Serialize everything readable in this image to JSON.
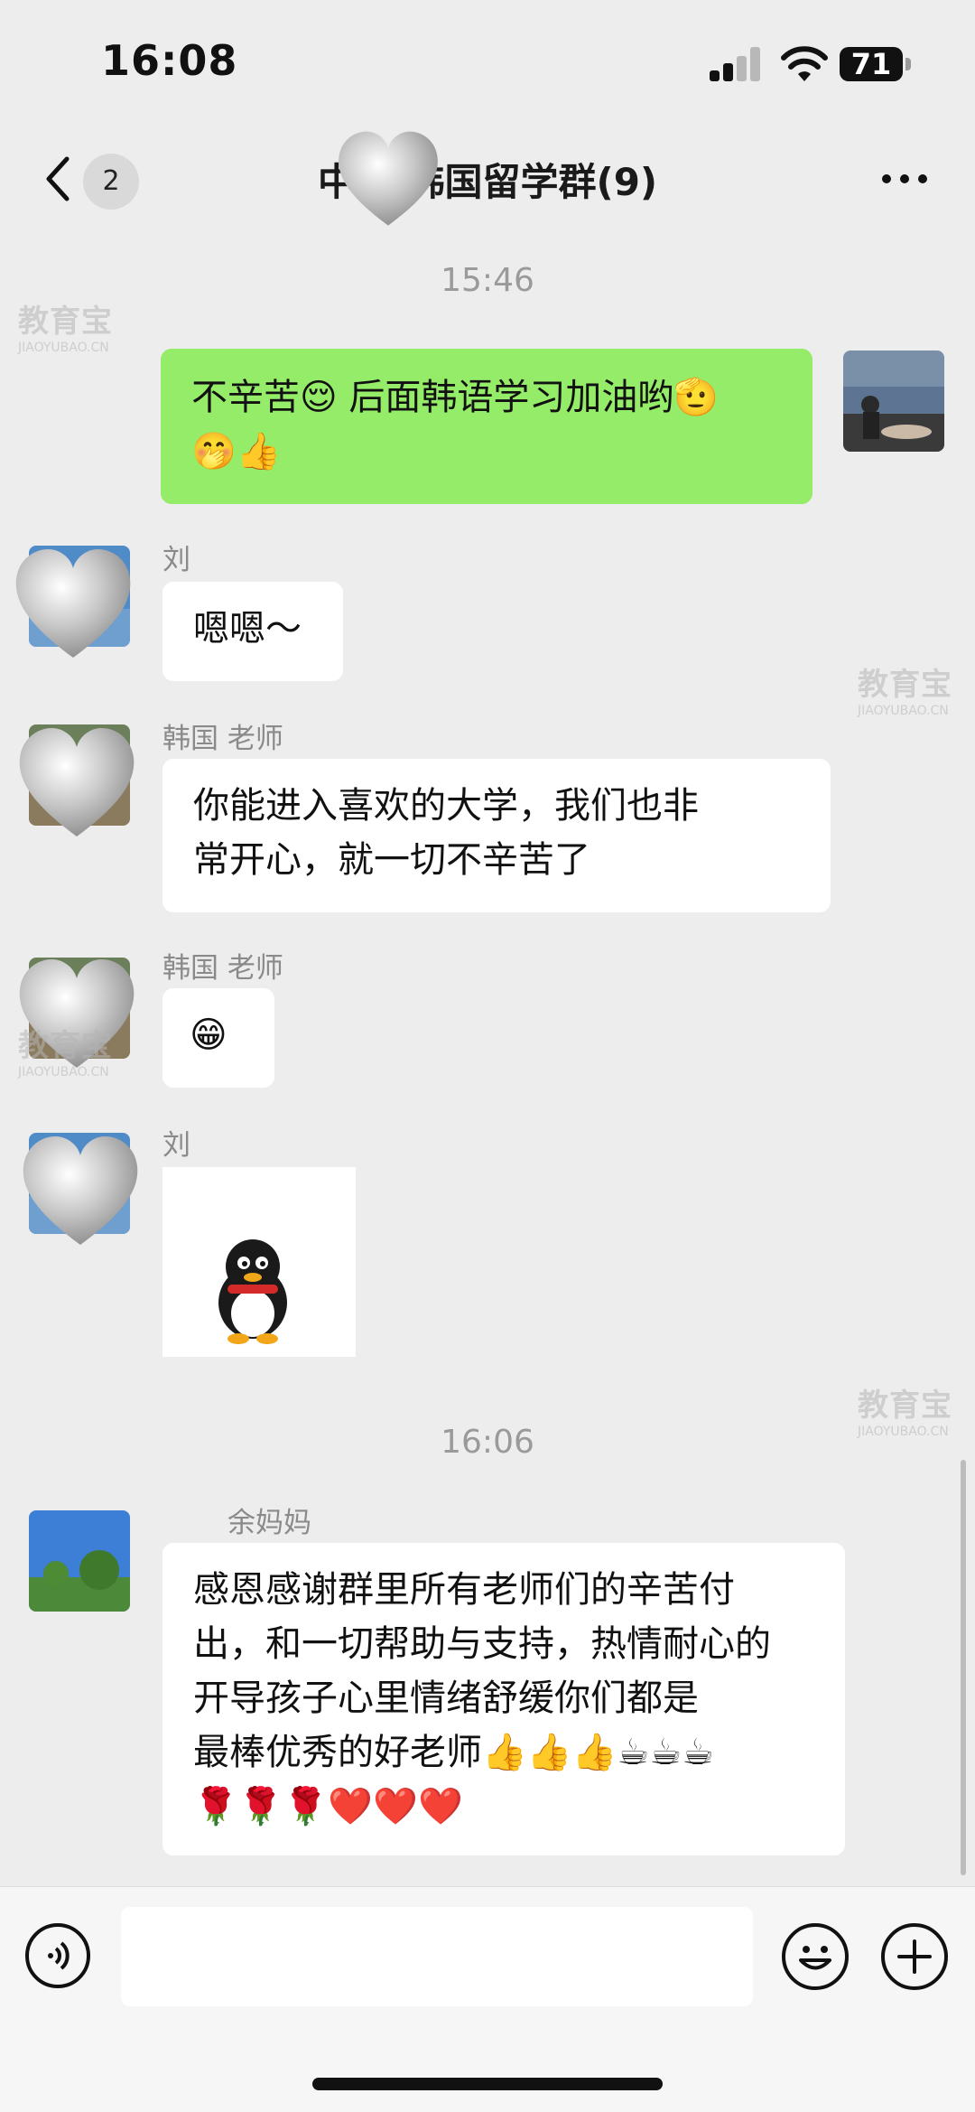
{
  "status_bar": {
    "time": "16:08",
    "battery": "71"
  },
  "nav": {
    "back_count": "2",
    "title": "中嘉 韩国留学群(9)"
  },
  "messages": [
    {
      "type": "timestamp",
      "text": "15:46"
    },
    {
      "type": "outgoing",
      "text": "不辛苦😌 后面韩语学习加油哟🫡",
      "text2": "🤭👍"
    },
    {
      "type": "incoming",
      "sender": "刘",
      "text": "嗯嗯～"
    },
    {
      "type": "incoming",
      "sender": "韩国 老师",
      "text": "你能进入喜欢的大学，我们也非",
      "text2": "常开心，就一切不辛苦了"
    },
    {
      "type": "incoming",
      "sender": "韩国 老师",
      "text": "😁"
    },
    {
      "type": "incoming",
      "sender": "刘",
      "sticker": "qq-penguin"
    },
    {
      "type": "timestamp",
      "text": "16:06"
    },
    {
      "type": "incoming",
      "sender": "余妈妈",
      "lines": [
        "感恩感谢群里所有老师们的辛苦付",
        "出，和一切帮助与支持，热情耐心的",
        "开导孩子心里情绪舒缓你们都是",
        "最棒优秀的好老师👍👍👍☕☕☕",
        "🌹🌹🌹❤️❤️❤️"
      ]
    }
  ],
  "watermark": {
    "text": "教育宝",
    "sub": "JIAOYUBAO.CN"
  },
  "icons": {
    "back": "chevron-left-icon",
    "more": "more-dots-icon",
    "voice": "voice-icon",
    "emoji": "emoji-icon",
    "plus": "plus-icon",
    "sticker": "heart-sticker"
  },
  "colors": {
    "outgoing_bubble": "#95ec69",
    "background": "#ededed",
    "bubble": "#ffffff"
  }
}
